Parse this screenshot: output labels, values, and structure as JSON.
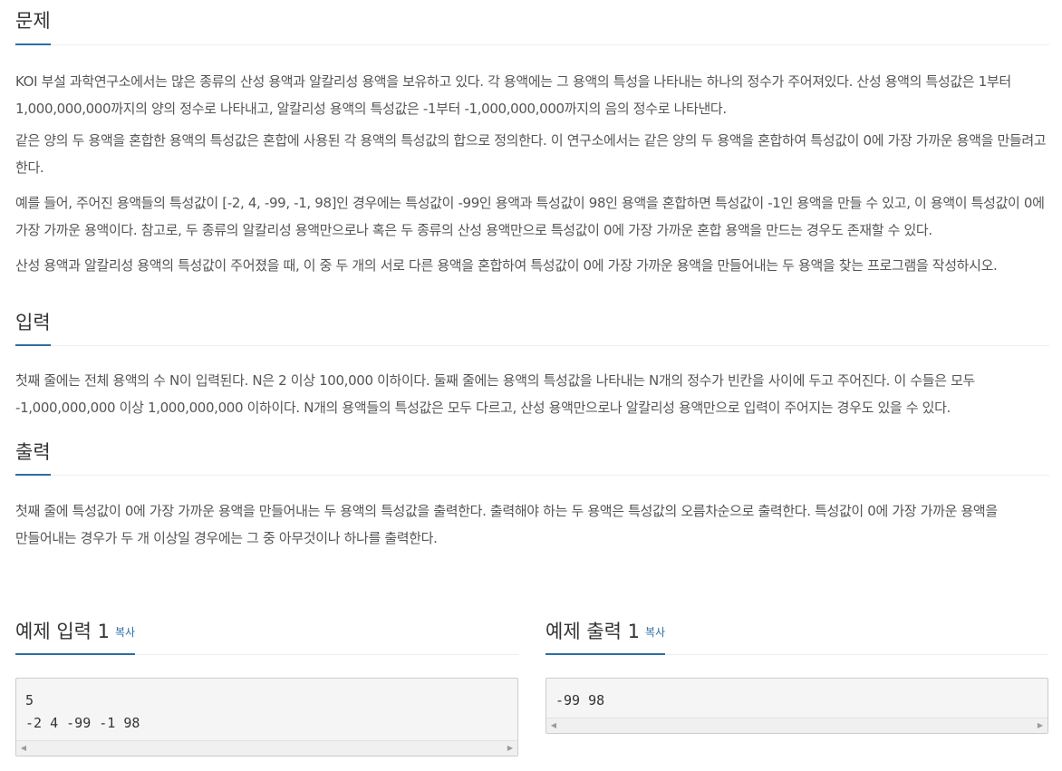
{
  "sections": {
    "problem": {
      "title": "문제",
      "paragraphs": [
        "KOI 부설 과학연구소에서는 많은 종류의 산성 용액과 알칼리성 용액을 보유하고 있다. 각 용액에는 그 용액의 특성을 나타내는 하나의 정수가 주어져있다. 산성 용액의 특성값은 1부터 1,000,000,000까지의 양의 정수로 나타내고, 알칼리성 용액의 특성값은 -1부터 -1,000,000,000까지의 음의 정수로 나타낸다.",
        "같은 양의 두 용액을 혼합한 용액의 특성값은 혼합에 사용된 각 용액의 특성값의 합으로 정의한다. 이 연구소에서는 같은 양의 두 용액을 혼합하여 특성값이 0에 가장 가까운 용액을 만들려고 한다.",
        "예를 들어, 주어진 용액들의 특성값이 [-2, 4, -99, -1, 98]인 경우에는 특성값이 -99인 용액과 특성값이 98인 용액을 혼합하면 특성값이 -1인 용액을 만들 수 있고, 이 용액이 특성값이 0에 가장 가까운 용액이다. 참고로, 두 종류의 알칼리성 용액만으로나 혹은 두 종류의 산성 용액만으로 특성값이 0에 가장 가까운 혼합 용액을 만드는 경우도 존재할 수 있다.",
        "산성 용액과 알칼리성 용액의 특성값이 주어졌을 때, 이 중 두 개의 서로 다른 용액을 혼합하여 특성값이 0에 가장 가까운 용액을 만들어내는 두 용액을 찾는 프로그램을 작성하시오."
      ]
    },
    "input": {
      "title": "입력",
      "paragraphs": [
        "첫째 줄에는 전체 용액의 수 N이 입력된다. N은 2 이상 100,000 이하이다. 둘째 줄에는 용액의 특성값을 나타내는 N개의 정수가 빈칸을 사이에 두고 주어진다. 이 수들은 모두 -1,000,000,000 이상 1,000,000,000 이하이다. N개의 용액들의 특성값은 모두 다르고, 산성 용액만으로나 알칼리성 용액만으로 입력이 주어지는 경우도 있을 수 있다."
      ]
    },
    "output": {
      "title": "출력",
      "paragraphs": [
        "첫째 줄에 특성값이 0에 가장 가까운 용액을 만들어내는 두 용액의 특성값을 출력한다. 출력해야 하는 두 용액은 특성값의 오름차순으로 출력한다. 특성값이 0에 가장 가까운 용액을 만들어내는 경우가 두 개 이상일 경우에는 그 중 아무것이나 하나를 출력한다."
      ]
    }
  },
  "samples": {
    "input": {
      "title": "예제 입력 1",
      "copy_label": "복사",
      "content": "5\n-2 4 -99 -1 98"
    },
    "output": {
      "title": "예제 출력 1",
      "copy_label": "복사",
      "content": "-99 98"
    }
  },
  "scrollbar": {
    "left_arrow": "◀",
    "right_arrow": "▶"
  },
  "colors": {
    "accent": "#2b6ea5",
    "text": "#555555",
    "sample_bg": "#f5f5f5"
  }
}
